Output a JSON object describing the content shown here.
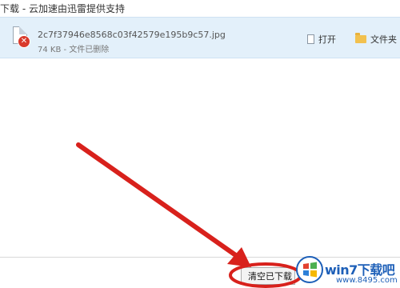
{
  "window": {
    "title": "下载 - 云加速由迅雷提供支持"
  },
  "download_item": {
    "file_name": "2c7f37946e8568c03f42579e195b9c57.jpg",
    "file_size": "74 KB",
    "separator": "-",
    "status": "文件已删除",
    "open_label": "打开",
    "folder_label": "文件夹",
    "file_icon": "image-file-icon",
    "status_icon": "error-icon"
  },
  "footer": {
    "clear_label": "清空已下载"
  },
  "annotation": {
    "arrow_color": "#d8211c"
  },
  "watermark": {
    "logo_icon": "windows-logo-icon",
    "site_title": "win7下载吧",
    "site_url": "www.8495.com"
  },
  "colors": {
    "item_highlight": "#e3f0fa",
    "watermark_blue": "#1d5fb8"
  }
}
